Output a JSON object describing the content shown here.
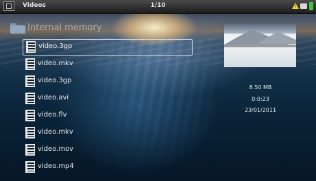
{
  "header": {
    "title": "Videos",
    "counter": "1/10"
  },
  "folder": {
    "label": "Internal memory"
  },
  "files": [
    {
      "name": "video.3gp"
    },
    {
      "name": "video.mkv"
    },
    {
      "name": "video.3gp"
    },
    {
      "name": "video.avi"
    },
    {
      "name": "video.flv"
    },
    {
      "name": "video.mkv"
    },
    {
      "name": "video.mov"
    },
    {
      "name": "video.mp4"
    }
  ],
  "details": {
    "size": "8.50 MB",
    "duration": "0:0:23",
    "date": "23/01/2011"
  },
  "colors": {
    "battery": "#47c23b",
    "warning": "#f2d12d"
  }
}
